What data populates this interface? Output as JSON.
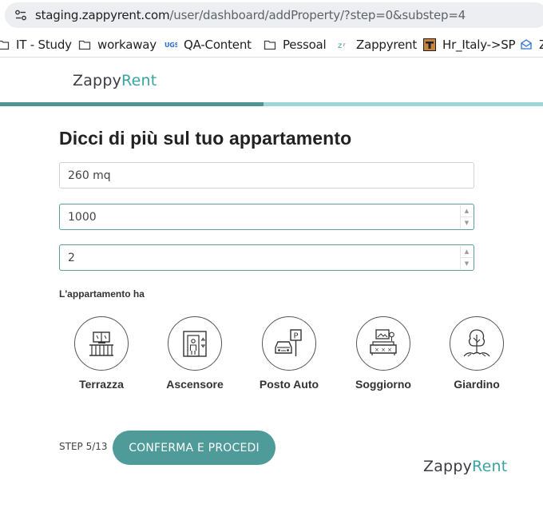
{
  "browser": {
    "url_host": "staging.zappyrent.com",
    "url_path": "/user/dashboard/addProperty/?step=0&substep=4",
    "bookmarks": [
      {
        "label": "IT - Study",
        "icon": "folder-icon"
      },
      {
        "label": "workaway",
        "icon": "folder-icon"
      },
      {
        "label": "QA-Content",
        "icon": "site-favicon-icon"
      },
      {
        "label": "Pessoal",
        "icon": "folder-icon"
      },
      {
        "label": "Zappyrent",
        "icon": "zappyrent-favicon-icon"
      },
      {
        "label": "Hr_Italy->SP",
        "icon": "site-favicon-icon"
      },
      {
        "label": "Z",
        "icon": "site-favicon-icon"
      }
    ]
  },
  "header": {
    "logo_part1": "Zappy",
    "logo_part2": "Rent",
    "progress_fraction": 0.485
  },
  "form": {
    "title": "Dicci di più sul tuo appartamento",
    "fields": [
      {
        "value": "260 mq"
      },
      {
        "value": "1000"
      },
      {
        "value": "2"
      }
    ],
    "amenities_label": "L'appartamento ha",
    "amenities": [
      {
        "label": "Terrazza",
        "icon": "terrace-icon"
      },
      {
        "label": "Ascensore",
        "icon": "elevator-icon"
      },
      {
        "label": "Posto Auto",
        "icon": "parking-icon"
      },
      {
        "label": "Soggiorno",
        "icon": "living-room-icon"
      },
      {
        "label": "Giardino",
        "icon": "garden-icon"
      }
    ]
  },
  "footer": {
    "step": "STEP 5/13",
    "confirm_label": "CONFERMA E PROCEDI",
    "logo_part1": "Zappy",
    "logo_part2": "Rent"
  },
  "colors": {
    "accent": "#4e9b9a",
    "progress_bg": "#9ed7d8",
    "progress_fill": "#4e9594",
    "logo_rent": "#3aa3a0"
  }
}
